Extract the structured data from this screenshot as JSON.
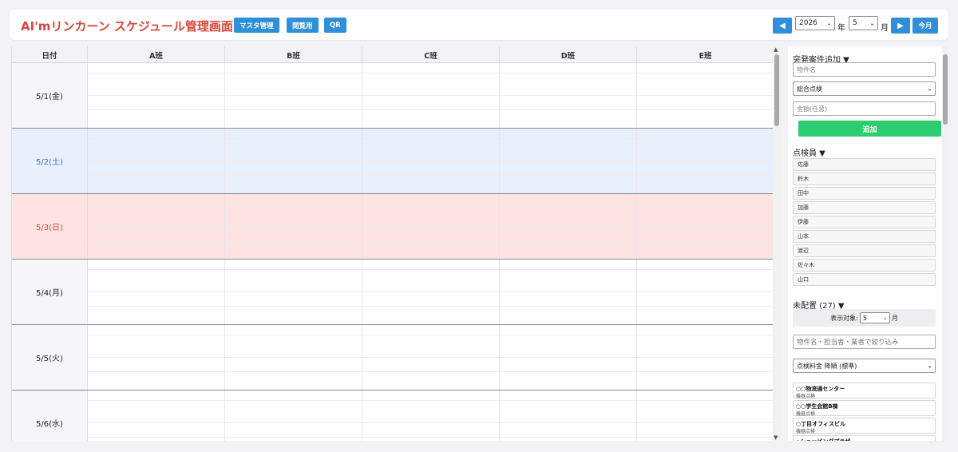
{
  "header": {
    "title": "AI'mリンカーン スケジュール管理画面",
    "buttons": [
      "マスタ管理",
      "閲覧用",
      "QR"
    ],
    "prev_icon": "◀",
    "next_icon": "▶",
    "year_value": "2026",
    "year_label": "年",
    "month_value": "5",
    "month_label": "月",
    "today_label": "今月"
  },
  "calendar": {
    "date_header": "日付",
    "columns": [
      "A班",
      "B班",
      "C班",
      "D班",
      "E班"
    ],
    "rows": [
      {
        "date": "5/1(金)",
        "kind": "weekday"
      },
      {
        "date": "5/2(土)",
        "kind": "saturday"
      },
      {
        "date": "5/3(日)",
        "kind": "holiday"
      },
      {
        "date": "5/4(月)",
        "kind": "weekday"
      },
      {
        "date": "5/5(火)",
        "kind": "weekday"
      },
      {
        "date": "5/6(水)",
        "kind": "weekday"
      }
    ],
    "colors": {
      "saturday_bg": "#e8effd",
      "saturday_text": "#3a6fd8",
      "holiday_bg": "#fde3e1",
      "holiday_text": "#d9473a"
    }
  },
  "sidebar": {
    "urgent": {
      "title": "突発案件追加 ▼",
      "property_placeholder": "物件名",
      "type_value": "総合点検",
      "amount_placeholder": "金額(任意)",
      "add_label": "追加"
    },
    "inspectors": {
      "title": "点検員 ▼",
      "names": [
        "佐藤",
        "鈴木",
        "田中",
        "加藤",
        "伊藤",
        "山本",
        "渡辺",
        "佐々木",
        "山口"
      ]
    },
    "unplaced": {
      "title": "未配置 (27) ▼",
      "filter_label": "表示対象:",
      "filter_month": "5",
      "filter_unit": "月",
      "search_placeholder": "物件名・担当者・業者で絞り込み",
      "sort_value": "点検料金 降順 (標準)",
      "items": [
        {
          "name": "○○物流通センター",
          "type": "機器点検"
        },
        {
          "name": "○○学生会館B棟",
          "type": "機器点検"
        },
        {
          "name": "○丁目オフィスビル",
          "type": "機器点検"
        },
        {
          "name": "△ショッピングプラザ",
          "type": ""
        }
      ]
    }
  }
}
